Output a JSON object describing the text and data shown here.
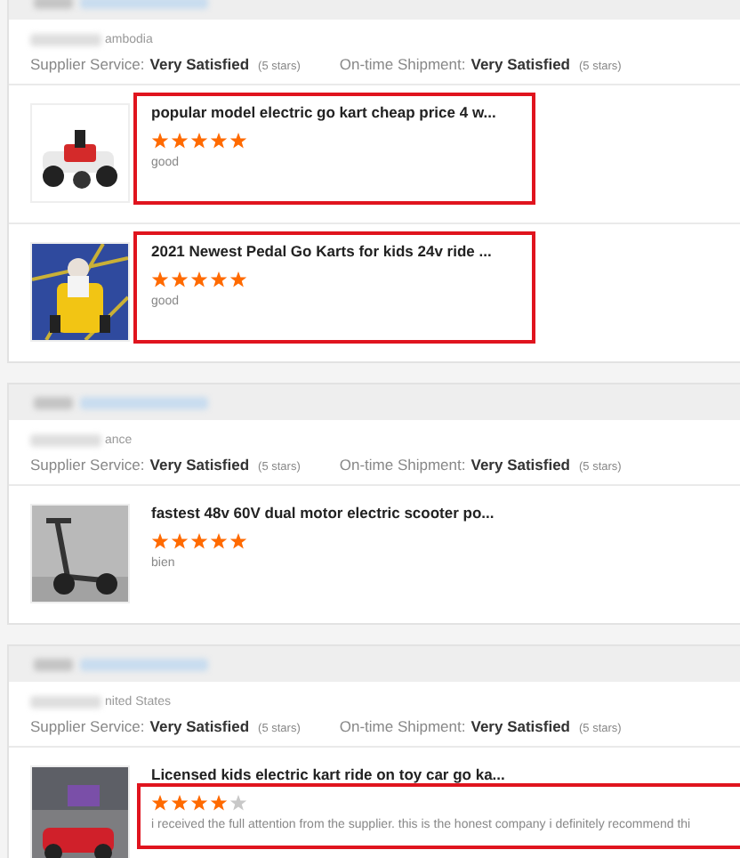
{
  "suppliers": [
    {
      "location": "ambodia",
      "supplier_service": {
        "label": "Supplier Service:",
        "value": "Very Satisfied",
        "stars": "(5 stars)"
      },
      "shipment": {
        "label": "On-time Shipment:",
        "value": "Very Satisfied",
        "stars": "(5 stars)"
      },
      "reviews": [
        {
          "product": "popular model electric go kart cheap price 4 w...",
          "stars": 5,
          "comment": "good",
          "highlighted": true,
          "kind": "whole"
        },
        {
          "product": "2021 Newest Pedal Go Karts for kids 24v ride ...",
          "stars": 5,
          "comment": "good",
          "highlighted": true,
          "kind": "whole"
        }
      ]
    },
    {
      "location": "ance",
      "supplier_service": {
        "label": "Supplier Service:",
        "value": "Very Satisfied",
        "stars": "(5 stars)"
      },
      "shipment": {
        "label": "On-time Shipment:",
        "value": "Very Satisfied",
        "stars": "(5 stars)"
      },
      "reviews": [
        {
          "product": "fastest 48v 60V dual motor electric scooter po...",
          "stars": 5,
          "comment": "bien",
          "highlighted": false,
          "kind": "whole"
        }
      ]
    },
    {
      "location": "nited States",
      "supplier_service": {
        "label": "Supplier Service:",
        "value": "Very Satisfied",
        "stars": "(5 stars)"
      },
      "shipment": {
        "label": "On-time Shipment:",
        "value": "Very Satisfied",
        "stars": "(5 stars)"
      },
      "reviews": [
        {
          "product": "Licensed kids electric kart ride on toy car go ka...",
          "stars": 4,
          "comment": "i received the full attention from the supplier. this is the honest company i  definitely recommend thi",
          "highlighted": true,
          "kind": "comment"
        }
      ]
    }
  ]
}
